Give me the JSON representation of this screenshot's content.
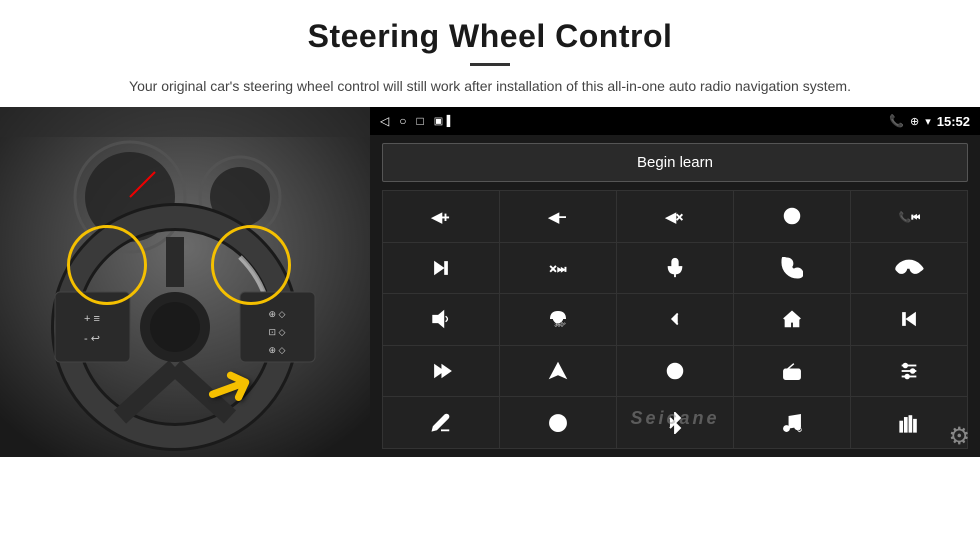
{
  "header": {
    "title": "Steering Wheel Control",
    "divider": true,
    "subtitle": "Your original car's steering wheel control will still work after installation of this all-in-one auto radio navigation system."
  },
  "head_unit": {
    "status_bar": {
      "back_icon": "◁",
      "circle_icon": "○",
      "square_icon": "□",
      "signal_icon": "▣",
      "phone_icon": "📞",
      "location_icon": "⊕",
      "wifi_icon": "▾",
      "time": "15:52"
    },
    "begin_learn_label": "Begin learn",
    "grid_buttons": [
      {
        "id": "vol-up",
        "icon": "vol_up"
      },
      {
        "id": "vol-down",
        "icon": "vol_down"
      },
      {
        "id": "vol-mute",
        "icon": "vol_mute"
      },
      {
        "id": "power",
        "icon": "power"
      },
      {
        "id": "prev-skip",
        "icon": "prev_skip"
      },
      {
        "id": "next-track",
        "icon": "next_track"
      },
      {
        "id": "fast-prev",
        "icon": "fast_prev"
      },
      {
        "id": "mic",
        "icon": "mic"
      },
      {
        "id": "phone",
        "icon": "phone"
      },
      {
        "id": "hang-up",
        "icon": "hang_up"
      },
      {
        "id": "horn",
        "icon": "horn"
      },
      {
        "id": "360-cam",
        "icon": "cam360"
      },
      {
        "id": "back",
        "icon": "back"
      },
      {
        "id": "home",
        "icon": "home"
      },
      {
        "id": "skip-back",
        "icon": "skip_back"
      },
      {
        "id": "fast-forward",
        "icon": "fast_forward"
      },
      {
        "id": "nav",
        "icon": "nav"
      },
      {
        "id": "source",
        "icon": "source"
      },
      {
        "id": "radio",
        "icon": "radio"
      },
      {
        "id": "eq",
        "icon": "eq"
      },
      {
        "id": "pen",
        "icon": "pen"
      },
      {
        "id": "dial",
        "icon": "dial"
      },
      {
        "id": "bluetooth",
        "icon": "bluetooth"
      },
      {
        "id": "music-settings",
        "icon": "music_settings"
      },
      {
        "id": "bars-eq",
        "icon": "bars_eq"
      }
    ],
    "seicane_watermark": "Seicane",
    "settings_icon": "⚙"
  }
}
